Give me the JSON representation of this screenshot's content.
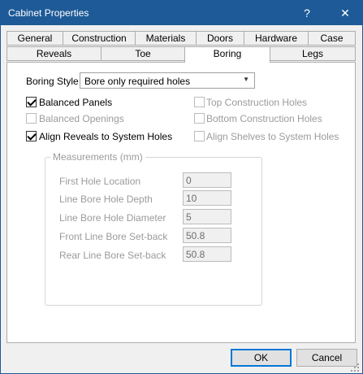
{
  "window": {
    "title": "Cabinet Properties",
    "help_label": "?",
    "close_label": "✕"
  },
  "tabs_row1": [
    "General",
    "Construction",
    "Materials",
    "Doors",
    "Hardware",
    "Case"
  ],
  "tabs_row2": [
    "Reveals",
    "Toe",
    "Boring",
    "Legs"
  ],
  "active_tab": "Boring",
  "boring_style": {
    "label": "Boring Style",
    "value": "Bore only required holes"
  },
  "checkboxes": {
    "balanced_panels": {
      "label": "Balanced Panels",
      "checked": true,
      "enabled": true
    },
    "balanced_openings": {
      "label": "Balanced Openings",
      "checked": false,
      "enabled": false
    },
    "align_reveals": {
      "label": "Align Reveals to System Holes",
      "checked": true,
      "enabled": true
    },
    "top_construction": {
      "label": "Top Construction Holes",
      "checked": false,
      "enabled": false
    },
    "bottom_construction": {
      "label": "Bottom Construction Holes",
      "checked": false,
      "enabled": false
    },
    "align_shelves": {
      "label": "Align Shelves to System Holes",
      "checked": false,
      "enabled": false
    }
  },
  "measurements": {
    "title": "Measurements (mm)",
    "first_hole_location": {
      "label": "First Hole Location",
      "value": "0"
    },
    "line_bore_depth": {
      "label": "Line Bore Hole Depth",
      "value": "10"
    },
    "line_bore_diameter": {
      "label": "Line Bore Hole Diameter",
      "value": "5"
    },
    "front_setback": {
      "label": "Front Line Bore Set-back",
      "value": "50.8"
    },
    "rear_setback": {
      "label": "Rear Line Bore Set-back",
      "value": "50.8"
    }
  },
  "buttons": {
    "ok": "OK",
    "cancel": "Cancel"
  }
}
